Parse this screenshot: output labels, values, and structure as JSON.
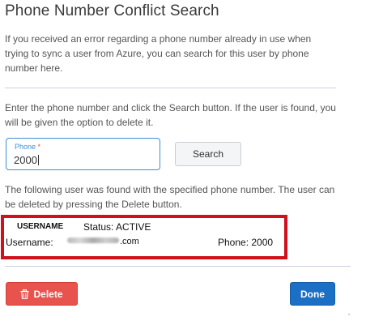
{
  "dialog": {
    "title": "Phone Number Conflict Search",
    "intro": "If you received an error regarding a phone number already in use when trying to sync a user from Azure, you can search for this user by phone number here.",
    "instructions": "Enter the phone number and click the Search button. If the user is found, you will be given the option to delete it."
  },
  "search": {
    "phone_label": "Phone",
    "required_marker": "*",
    "phone_value": "2000",
    "search_label": "Search"
  },
  "result": {
    "found_message": "The following user was found with the specified phone number. The user can be deleted by pressing the Delete button.",
    "username_header": "USERNAME",
    "status": "Status: ACTIVE",
    "username_label": "Username:",
    "username_suffix": ".com",
    "phone": "Phone: 2000"
  },
  "footer": {
    "delete_label": "Delete",
    "done_label": "Done"
  },
  "colors": {
    "primary": "#1b6fc4",
    "danger": "#e8534d",
    "highlight_border": "#d0111b",
    "input_focus": "#3b8fd9"
  }
}
